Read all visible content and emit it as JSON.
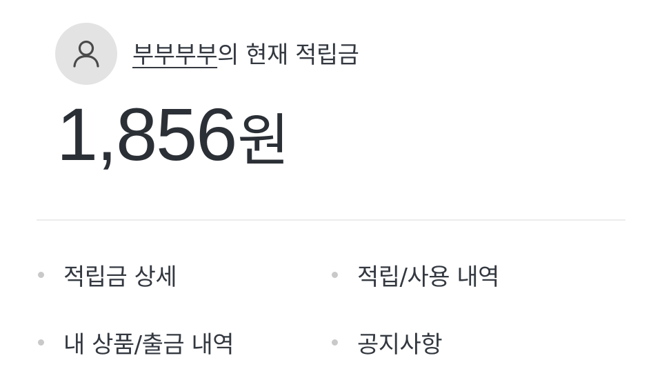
{
  "profile": {
    "avatar_icon": "person-icon",
    "nickname": "부부부부",
    "suffix": "의 현재 적립금"
  },
  "balance": {
    "amount": "1,856",
    "unit": "원"
  },
  "menu": {
    "items": [
      {
        "label": "적립금 상세"
      },
      {
        "label": "적립/사용 내역"
      },
      {
        "label": "내 상품/출금 내역"
      },
      {
        "label": "공지사항"
      }
    ]
  },
  "colors": {
    "text": "#2b2f36",
    "avatar_bg": "#e3e3e3",
    "bullet": "#c9c9c9",
    "divider": "#ececec"
  }
}
